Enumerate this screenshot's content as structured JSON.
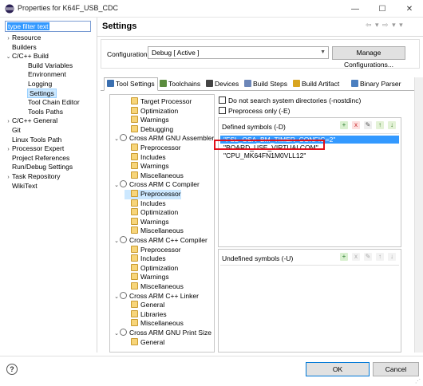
{
  "window": {
    "title": "Properties for K64F_USB_CDC",
    "minimize": "—",
    "maximize": "☐",
    "close": "✕"
  },
  "filter": {
    "value": "type filter text"
  },
  "left_tree": [
    {
      "label": "Resource",
      "indent": 0,
      "twisty": ">"
    },
    {
      "label": "Builders",
      "indent": 0,
      "twisty": ""
    },
    {
      "label": "C/C++ Build",
      "indent": 0,
      "twisty": "v"
    },
    {
      "label": "Build Variables",
      "indent": 1,
      "twisty": ""
    },
    {
      "label": "Environment",
      "indent": 1,
      "twisty": ""
    },
    {
      "label": "Logging",
      "indent": 1,
      "twisty": ""
    },
    {
      "label": "Settings",
      "indent": 1,
      "twisty": "",
      "selected": true
    },
    {
      "label": "Tool Chain Editor",
      "indent": 1,
      "twisty": ""
    },
    {
      "label": "Tools Paths",
      "indent": 1,
      "twisty": ""
    },
    {
      "label": "C/C++ General",
      "indent": 0,
      "twisty": ">"
    },
    {
      "label": "Git",
      "indent": 0,
      "twisty": ""
    },
    {
      "label": "Linux Tools Path",
      "indent": 0,
      "twisty": ""
    },
    {
      "label": "Processor Expert",
      "indent": 0,
      "twisty": ">"
    },
    {
      "label": "Project References",
      "indent": 0,
      "twisty": ""
    },
    {
      "label": "Run/Debug Settings",
      "indent": 0,
      "twisty": ""
    },
    {
      "label": "Task Repository",
      "indent": 0,
      "twisty": ">"
    },
    {
      "label": "WikiText",
      "indent": 0,
      "twisty": ""
    }
  ],
  "header": {
    "title": "Settings",
    "nav": "⇦ ▾ ⇨ ▾ ▾"
  },
  "config": {
    "label": "Configuration:",
    "value": "Debug  [ Active ]",
    "manage_button": "Manage Configurations..."
  },
  "tabs": [
    {
      "label": "Tool Settings",
      "active": true,
      "color": "#3a6fb0"
    },
    {
      "label": "Toolchains",
      "active": false,
      "color": "#5b8c3e"
    },
    {
      "label": "Devices",
      "active": false,
      "color": "#444444"
    },
    {
      "label": "Build Steps",
      "active": false,
      "color": "#6c86b8"
    },
    {
      "label": "Build Artifact",
      "active": false,
      "color": "#d9a520"
    },
    {
      "label": "Binary Parser",
      "active": false,
      "color": "#4a7fc0"
    }
  ],
  "tool_tree": [
    {
      "label": "Target Processor",
      "indent": 1,
      "twisty": "",
      "kind": "page"
    },
    {
      "label": "Optimization",
      "indent": 1,
      "twisty": "",
      "kind": "page"
    },
    {
      "label": "Warnings",
      "indent": 1,
      "twisty": "",
      "kind": "page"
    },
    {
      "label": "Debugging",
      "indent": 1,
      "twisty": "",
      "kind": "page"
    },
    {
      "label": "Cross ARM GNU Assembler",
      "indent": 0,
      "twisty": "v",
      "kind": "tool"
    },
    {
      "label": "Preprocessor",
      "indent": 2,
      "twisty": "",
      "kind": "page"
    },
    {
      "label": "Includes",
      "indent": 2,
      "twisty": "",
      "kind": "page"
    },
    {
      "label": "Warnings",
      "indent": 2,
      "twisty": "",
      "kind": "page"
    },
    {
      "label": "Miscellaneous",
      "indent": 2,
      "twisty": "",
      "kind": "page"
    },
    {
      "label": "Cross ARM C Compiler",
      "indent": 0,
      "twisty": "v",
      "kind": "tool"
    },
    {
      "label": "Preprocessor",
      "indent": 2,
      "twisty": "",
      "kind": "page",
      "selected": true
    },
    {
      "label": "Includes",
      "indent": 2,
      "twisty": "",
      "kind": "page"
    },
    {
      "label": "Optimization",
      "indent": 2,
      "twisty": "",
      "kind": "page"
    },
    {
      "label": "Warnings",
      "indent": 2,
      "twisty": "",
      "kind": "page"
    },
    {
      "label": "Miscellaneous",
      "indent": 2,
      "twisty": "",
      "kind": "page"
    },
    {
      "label": "Cross ARM C++ Compiler",
      "indent": 0,
      "twisty": "v",
      "kind": "tool"
    },
    {
      "label": "Preprocessor",
      "indent": 2,
      "twisty": "",
      "kind": "page"
    },
    {
      "label": "Includes",
      "indent": 2,
      "twisty": "",
      "kind": "page"
    },
    {
      "label": "Optimization",
      "indent": 2,
      "twisty": "",
      "kind": "page"
    },
    {
      "label": "Warnings",
      "indent": 2,
      "twisty": "",
      "kind": "page"
    },
    {
      "label": "Miscellaneous",
      "indent": 2,
      "twisty": "",
      "kind": "page"
    },
    {
      "label": "Cross ARM C++ Linker",
      "indent": 0,
      "twisty": "v",
      "kind": "tool"
    },
    {
      "label": "General",
      "indent": 2,
      "twisty": "",
      "kind": "page"
    },
    {
      "label": "Libraries",
      "indent": 2,
      "twisty": "",
      "kind": "page"
    },
    {
      "label": "Miscellaneous",
      "indent": 2,
      "twisty": "",
      "kind": "page"
    },
    {
      "label": "Cross ARM GNU Print Size",
      "indent": 0,
      "twisty": "v",
      "kind": "tool"
    },
    {
      "label": "General",
      "indent": 2,
      "twisty": "",
      "kind": "page"
    }
  ],
  "options": {
    "nostdinc": "Do not search system directories (-nostdinc)",
    "preprocess_only": "Preprocess only (-E)"
  },
  "defined": {
    "title": "Defined symbols (-D)",
    "symbols": [
      {
        "text": "\"FSL_OSA_BM_TIMER_CONFIG=2\"",
        "selected": true
      },
      {
        "text": "\"BOARD_USE_VIRTUALCOM\"",
        "selected": false
      },
      {
        "text": "\"CPU_MK64FN1M0VLL12\"",
        "selected": false
      }
    ]
  },
  "undefined": {
    "title": "Undefined symbols (-U)"
  },
  "toolbar_icons": {
    "add": "+",
    "delete": "x",
    "edit": "✎",
    "up": "↑",
    "down": "↓"
  },
  "colors": {
    "selection": "#3399ff",
    "highlight_box": "#e0101a",
    "tree_selection": "#cce8ff"
  },
  "buttons": {
    "help": "?",
    "ok": "OK",
    "cancel": "Cancel"
  }
}
